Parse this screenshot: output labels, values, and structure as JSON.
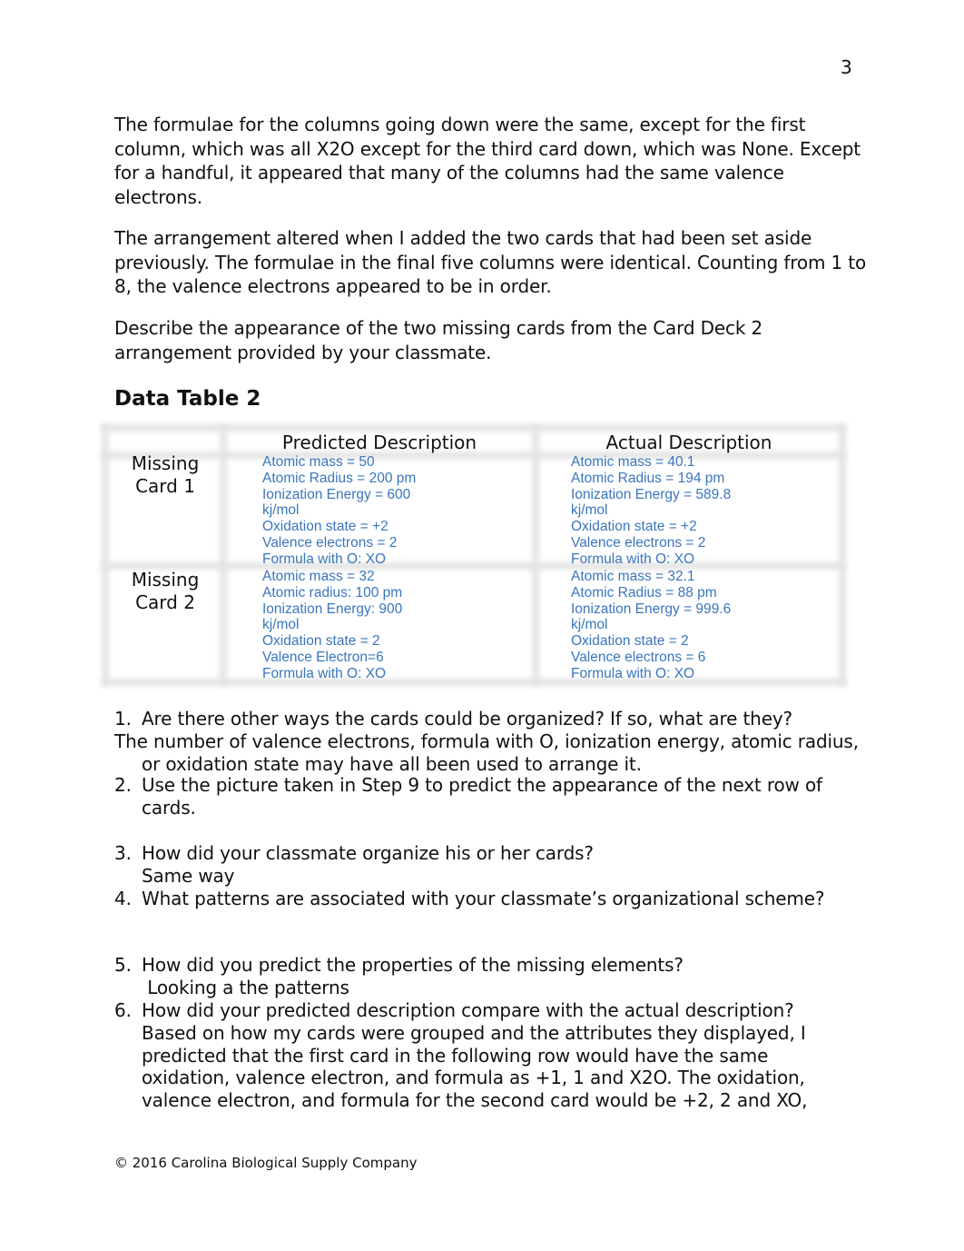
{
  "page_number": "3",
  "paragraphs": [
    "The formulae for the columns going down were the same, except for the first column, which was all X2O except for the third card down, which was None. Except for a handful, it appeared that many of the columns had the same valence electrons.",
    "The arrangement altered when I added the two cards that had been set aside previously. The formulae in the final five columns were identical. Counting from 1 to 8, the valence electrons appeared to be in order.",
    "Describe the appearance of the two missing cards from the Card Deck 2 arrangement provided by your classmate."
  ],
  "data_table": {
    "title": "Data Table 2",
    "headers": [
      "",
      "Predicted Description",
      "Actual Description"
    ],
    "rows": [
      {
        "label_line1": "Missing",
        "label_line2": "Card 1",
        "predicted": [
          "Atomic mass = 50",
          "Atomic Radius = 200 pm",
          "Ionization Energy = 600",
          "kj/mol",
          "Oxidation state = +2",
          "Valence electrons = 2",
          "Formula with O: XO"
        ],
        "actual": [
          "Atomic mass = 40.1",
          "Atomic Radius = 194 pm",
          "Ionization Energy = 589.8",
          "kj/mol",
          "Oxidation state = +2",
          "Valence electrons = 2",
          "Formula with O: XO"
        ]
      },
      {
        "label_line1": "Missing",
        "label_line2": "Card 2",
        "predicted": [
          "Atomic mass = 32",
          "Atomic radius: 100 pm",
          "Ionization Energy: 900",
          "kj/mol",
          "Oxidation state = 2",
          "Valence Electron=6",
          "Formula with O: XO"
        ],
        "actual": [
          "Atomic mass = 32.1",
          "Atomic Radius = 88 pm",
          "Ionization Energy = 999.6",
          "kj/mol",
          "Oxidation state = 2",
          "Valence electrons = 6",
          "Formula with O: XO"
        ]
      }
    ],
    "text_color": "#3a76bd"
  },
  "questions": [
    {
      "num": "1.",
      "text": "Are there other ways the cards could be organized? If so, what are they?",
      "answer": "The number of valence electrons, formula with O, ionization energy, atomic radius, or oxidation state may have all been used to arrange it."
    },
    {
      "num": "2.",
      "text": "Use the picture taken in Step 9 to predict the appearance of the next row of cards.",
      "answer": ""
    },
    {
      "num": "3.",
      "text": "How did your classmate organize his or her cards?",
      "answer": "Same way"
    },
    {
      "num": "4.",
      "text": "What patterns are associated with your classmate’s organizational scheme?",
      "answer": ""
    },
    {
      "num": "5.",
      "text": "How did you predict the properties of the missing elements?",
      "answer": " Looking a the patterns"
    },
    {
      "num": "6.",
      "text": "How did your predicted description compare with the actual description?",
      "answer": "Based on how my cards were grouped and the attributes they displayed, I predicted that the first card in the following row would have the same oxidation, valence electron, and formula as +1, 1 and X2O. The oxidation, valence electron, and formula for the second card would be +2, 2 and XO,"
    }
  ],
  "footer": "© 2016 Carolina Biological Supply Company"
}
